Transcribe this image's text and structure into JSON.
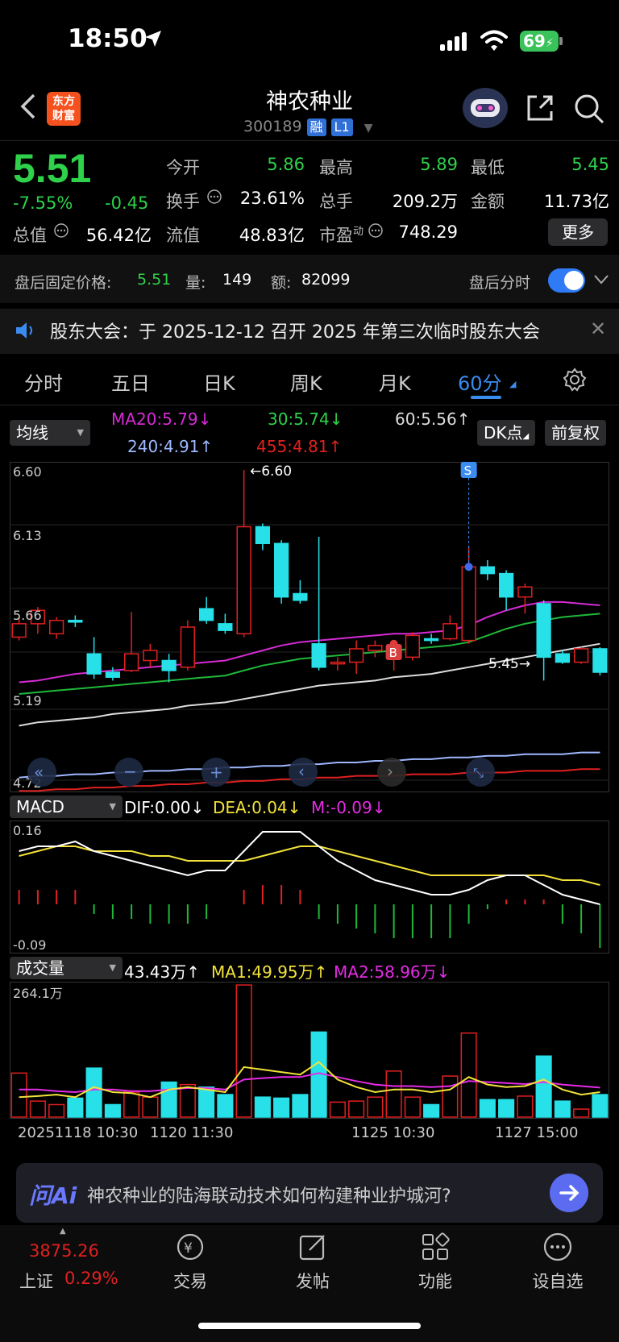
{
  "status": {
    "time": "18:50",
    "battery": "69"
  },
  "header": {
    "logo": "东方\n财富",
    "logo_line1": "东方",
    "logo_line2": "财富",
    "name": "神农种业",
    "code": "300189",
    "tag1": "融",
    "tag2": "L1"
  },
  "quote": {
    "price": "5.51",
    "pct": "-7.55%",
    "change": "-0.45",
    "open_label": "今开",
    "open": "5.86",
    "high_label": "最高",
    "high": "5.89",
    "low_label": "最低",
    "low": "5.45",
    "turnover_label": "换手",
    "turnover": "23.61%",
    "volume_label": "总手",
    "volume": "209.2万",
    "amount_label": "金额",
    "amount": "11.73亿",
    "mcap_label": "总值",
    "mcap": "56.42亿",
    "float_label": "流值",
    "float": "48.83亿",
    "pe_label": "市盈",
    "pe_sup": "动",
    "pe": "748.29",
    "more": "更多"
  },
  "after_hours": {
    "label": "盘后固定价格:",
    "price": "5.51",
    "vol_label": "量:",
    "vol": "149",
    "amt_label": "额:",
    "amt": "82099",
    "toggle_label": "盘后分时"
  },
  "notice": {
    "text": "股东大会：于 2025-12-12 召开 2025 年第三次临时股东大会"
  },
  "tabs": [
    "分时",
    "五日",
    "日K",
    "周K",
    "月K",
    "60分"
  ],
  "chart_controls": {
    "indicator": "均线",
    "dk": "DK点",
    "adjust": "前复权"
  },
  "ma_legend": {
    "ma20": "MA20:5.79↓",
    "ma30": "30:5.74↓",
    "ma60": "60:5.56↑",
    "ma240": "240:4.91↑",
    "ma455": "455:4.81↑"
  },
  "macd_legend": {
    "name": "MACD",
    "dif": "DIF:0.00↓",
    "dea": "DEA:0.04↓",
    "m": "M:-0.09↓"
  },
  "vol_legend": {
    "name": "成交量",
    "vol": "43.43万↑",
    "ma1": "MA1:49.95万↑",
    "ma2": "MA2:58.96万↓"
  },
  "chart_data": [
    {
      "type": "candlestick",
      "title": "60分",
      "y_ticks": [
        "6.60",
        "6.13",
        "5.66",
        "5.19",
        "4.72"
      ],
      "ylim": [
        4.72,
        6.6
      ],
      "annotations": {
        "high": "←6.60",
        "low": "5.45→",
        "buy": "B",
        "sell": "S"
      },
      "candles": [
        {
          "o": 5.6,
          "c": 5.68,
          "h": 5.72,
          "l": 5.58
        },
        {
          "o": 5.68,
          "c": 5.76,
          "h": 5.78,
          "l": 5.62
        },
        {
          "o": 5.62,
          "c": 5.7,
          "h": 5.72,
          "l": 5.59
        },
        {
          "o": 5.7,
          "c": 5.69,
          "h": 5.73,
          "l": 5.66
        },
        {
          "o": 5.5,
          "c": 5.38,
          "h": 5.6,
          "l": 5.35
        },
        {
          "o": 5.39,
          "c": 5.36,
          "h": 5.42,
          "l": 5.34
        },
        {
          "o": 5.4,
          "c": 5.5,
          "h": 5.75,
          "l": 5.39
        },
        {
          "o": 5.46,
          "c": 5.52,
          "h": 5.56,
          "l": 5.42
        },
        {
          "o": 5.46,
          "c": 5.4,
          "h": 5.5,
          "l": 5.33
        },
        {
          "o": 5.42,
          "c": 5.66,
          "h": 5.7,
          "l": 5.4
        },
        {
          "o": 5.77,
          "c": 5.7,
          "h": 5.84,
          "l": 5.68
        },
        {
          "o": 5.68,
          "c": 5.64,
          "h": 5.74,
          "l": 5.62
        },
        {
          "o": 5.62,
          "c": 6.26,
          "h": 6.6,
          "l": 5.6
        },
        {
          "o": 6.26,
          "c": 6.16,
          "h": 6.28,
          "l": 6.12
        },
        {
          "o": 6.16,
          "c": 5.84,
          "h": 6.18,
          "l": 5.8
        },
        {
          "o": 5.86,
          "c": 5.82,
          "h": 5.94,
          "l": 5.8
        },
        {
          "o": 5.56,
          "c": 5.42,
          "h": 6.2,
          "l": 5.4
        },
        {
          "o": 5.44,
          "c": 5.45,
          "h": 5.48,
          "l": 5.4
        },
        {
          "o": 5.45,
          "c": 5.53,
          "h": 5.58,
          "l": 5.38
        },
        {
          "o": 5.52,
          "c": 5.55,
          "h": 5.58,
          "l": 5.48
        },
        {
          "o": 5.47,
          "c": 5.48,
          "h": 5.56,
          "l": 5.4
        },
        {
          "o": 5.48,
          "c": 5.61,
          "h": 5.63,
          "l": 5.46
        },
        {
          "o": 5.59,
          "c": 5.58,
          "h": 5.62,
          "l": 5.56
        },
        {
          "o": 5.59,
          "c": 5.68,
          "h": 5.73,
          "l": 5.58
        },
        {
          "o": 5.58,
          "c": 6.02,
          "h": 6.14,
          "l": 5.56
        },
        {
          "o": 6.02,
          "c": 5.98,
          "h": 6.06,
          "l": 5.94
        },
        {
          "o": 5.98,
          "c": 5.84,
          "h": 6.0,
          "l": 5.76
        },
        {
          "o": 5.84,
          "c": 5.9,
          "h": 5.92,
          "l": 5.74
        },
        {
          "o": 5.8,
          "c": 5.48,
          "h": 5.82,
          "l": 5.34
        },
        {
          "o": 5.5,
          "c": 5.45,
          "h": 5.52,
          "l": 5.44
        },
        {
          "o": 5.45,
          "c": 5.53,
          "h": 5.54,
          "l": 5.44
        },
        {
          "o": 5.53,
          "c": 5.39,
          "h": 5.54,
          "l": 5.37
        }
      ],
      "ma20": [
        5.33,
        5.34,
        5.36,
        5.38,
        5.39,
        5.4,
        5.41,
        5.42,
        5.43,
        5.44,
        5.45,
        5.46,
        5.49,
        5.52,
        5.55,
        5.57,
        5.58,
        5.59,
        5.6,
        5.61,
        5.62,
        5.62,
        5.63,
        5.64,
        5.67,
        5.72,
        5.76,
        5.79,
        5.81,
        5.81,
        5.8,
        5.79
      ],
      "ma30": [
        5.26,
        5.27,
        5.28,
        5.29,
        5.3,
        5.31,
        5.32,
        5.33,
        5.34,
        5.35,
        5.36,
        5.37,
        5.4,
        5.43,
        5.45,
        5.47,
        5.48,
        5.49,
        5.5,
        5.51,
        5.52,
        5.53,
        5.54,
        5.55,
        5.57,
        5.61,
        5.65,
        5.68,
        5.7,
        5.72,
        5.73,
        5.74
      ],
      "ma60": [
        5.07,
        5.09,
        5.1,
        5.11,
        5.12,
        5.14,
        5.15,
        5.16,
        5.17,
        5.19,
        5.2,
        5.21,
        5.23,
        5.25,
        5.27,
        5.29,
        5.31,
        5.32,
        5.33,
        5.34,
        5.36,
        5.37,
        5.38,
        5.4,
        5.42,
        5.44,
        5.46,
        5.48,
        5.5,
        5.52,
        5.54,
        5.56
      ],
      "ma240": [
        4.76,
        4.77,
        4.77,
        4.78,
        4.78,
        4.79,
        4.79,
        4.8,
        4.8,
        4.81,
        4.81,
        4.82,
        4.82,
        4.83,
        4.83,
        4.84,
        4.84,
        4.85,
        4.85,
        4.86,
        4.86,
        4.87,
        4.87,
        4.88,
        4.88,
        4.89,
        4.89,
        4.9,
        4.9,
        4.9,
        4.91,
        4.91
      ],
      "ma455": [
        4.68,
        4.68,
        4.69,
        4.69,
        4.7,
        4.7,
        4.71,
        4.71,
        4.72,
        4.72,
        4.73,
        4.73,
        4.74,
        4.74,
        4.75,
        4.75,
        4.76,
        4.76,
        4.77,
        4.77,
        4.77,
        4.78,
        4.78,
        4.78,
        4.79,
        4.79,
        4.79,
        4.8,
        4.8,
        4.8,
        4.81,
        4.81
      ]
    },
    {
      "type": "macd",
      "y_ticks": [
        "0.16",
        "-0.09"
      ],
      "ylim": [
        -0.09,
        0.16
      ],
      "dif": [
        0.11,
        0.12,
        0.12,
        0.13,
        0.11,
        0.1,
        0.09,
        0.08,
        0.07,
        0.06,
        0.07,
        0.07,
        0.11,
        0.15,
        0.15,
        0.15,
        0.12,
        0.09,
        0.07,
        0.05,
        0.04,
        0.03,
        0.02,
        0.02,
        0.03,
        0.05,
        0.06,
        0.06,
        0.04,
        0.02,
        0.01,
        0.0
      ],
      "dea": [
        0.1,
        0.11,
        0.12,
        0.12,
        0.11,
        0.11,
        0.11,
        0.1,
        0.1,
        0.09,
        0.09,
        0.09,
        0.09,
        0.1,
        0.11,
        0.12,
        0.12,
        0.11,
        0.1,
        0.09,
        0.08,
        0.07,
        0.06,
        0.06,
        0.06,
        0.06,
        0.06,
        0.06,
        0.06,
        0.05,
        0.05,
        0.04
      ],
      "m": [
        0.03,
        0.03,
        0.03,
        0.03,
        -0.02,
        -0.03,
        -0.03,
        -0.04,
        -0.04,
        -0.04,
        -0.03,
        0,
        0.03,
        0.04,
        0.04,
        0.03,
        -0.03,
        -0.04,
        -0.05,
        -0.06,
        -0.07,
        -0.07,
        -0.07,
        -0.07,
        -0.04,
        -0.01,
        0.01,
        0.01,
        0.01,
        -0.04,
        -0.06,
        -0.09
      ]
    },
    {
      "type": "bar",
      "title": "成交量",
      "y_ticks": [
        "264.1万"
      ],
      "ylim": [
        0,
        264.1
      ],
      "x_ticks": [
        "20251118 10:30",
        "1120 11:30",
        "1125 10:30",
        "1127 15:00"
      ],
      "values": [
        88,
        32,
        25,
        38,
        98,
        25,
        50,
        40,
        70,
        65,
        60,
        45,
        264,
        40,
        38,
        45,
        170,
        30,
        32,
        40,
        92,
        40,
        25,
        82,
        168,
        35,
        35,
        42,
        122,
        32,
        16,
        45
      ],
      "ma1": [
        40,
        42,
        45,
        40,
        60,
        50,
        48,
        40,
        55,
        60,
        55,
        50,
        100,
        95,
        90,
        85,
        110,
        75,
        60,
        50,
        55,
        55,
        50,
        55,
        80,
        65,
        60,
        62,
        75,
        55,
        45,
        50
      ],
      "ma2": [
        55,
        55,
        52,
        50,
        55,
        55,
        52,
        52,
        55,
        58,
        58,
        55,
        75,
        78,
        80,
        80,
        88,
        80,
        72,
        65,
        62,
        62,
        60,
        62,
        72,
        70,
        68,
        66,
        70,
        65,
        62,
        59
      ]
    }
  ],
  "ai": {
    "logo": "问Ai",
    "question": "神农种业的陆海联动技术如何构建种业护城河?"
  },
  "bottom_nav": {
    "index_value": "3875.26",
    "index_name": "上证",
    "index_pct": "0.29%",
    "items": [
      "交易",
      "发帖",
      "功能",
      "设自选"
    ]
  },
  "colors": {
    "up": "#e02020",
    "down": "#27e0e8",
    "green": "#2fd14a",
    "accent": "#3b8cf0"
  }
}
